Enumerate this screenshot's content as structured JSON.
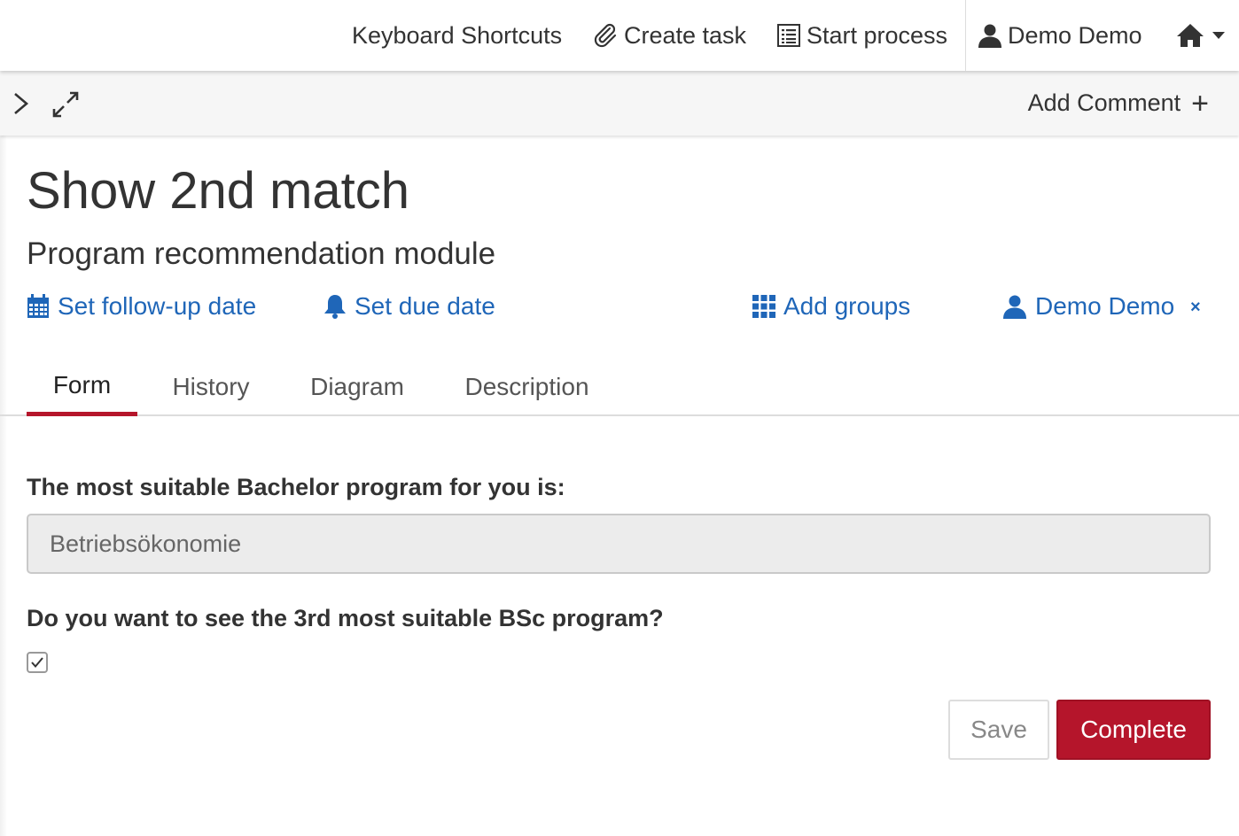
{
  "topbar": {
    "keyboard_shortcuts": "Keyboard Shortcuts",
    "create_task": "Create task",
    "start_process": "Start process",
    "user": "Demo Demo",
    "home_icon": "home-icon"
  },
  "subbar": {
    "add_comment": "Add Comment",
    "add_comment_symbol": "+"
  },
  "task": {
    "title": "Show 2nd match",
    "process_name": "Program recommendation module",
    "actions": {
      "follow_up": "Set follow-up date",
      "due_date": "Set due date",
      "groups": "Add groups",
      "assignee": "Demo Demo",
      "remove_symbol": "×"
    }
  },
  "tabs": [
    {
      "label": "Form",
      "active": true
    },
    {
      "label": "History",
      "active": false
    },
    {
      "label": "Diagram",
      "active": false
    },
    {
      "label": "Description",
      "active": false
    }
  ],
  "form": {
    "field1_label": "The most suitable Bachelor program for you is:",
    "field1_value": "Betriebsökonomie",
    "field2_label": "Do you want to see the 3rd most suitable BSc program?",
    "field2_checked": true,
    "save_label": "Save",
    "complete_label": "Complete"
  },
  "colors": {
    "link": "#1f66b8",
    "accent": "#b5152b"
  }
}
